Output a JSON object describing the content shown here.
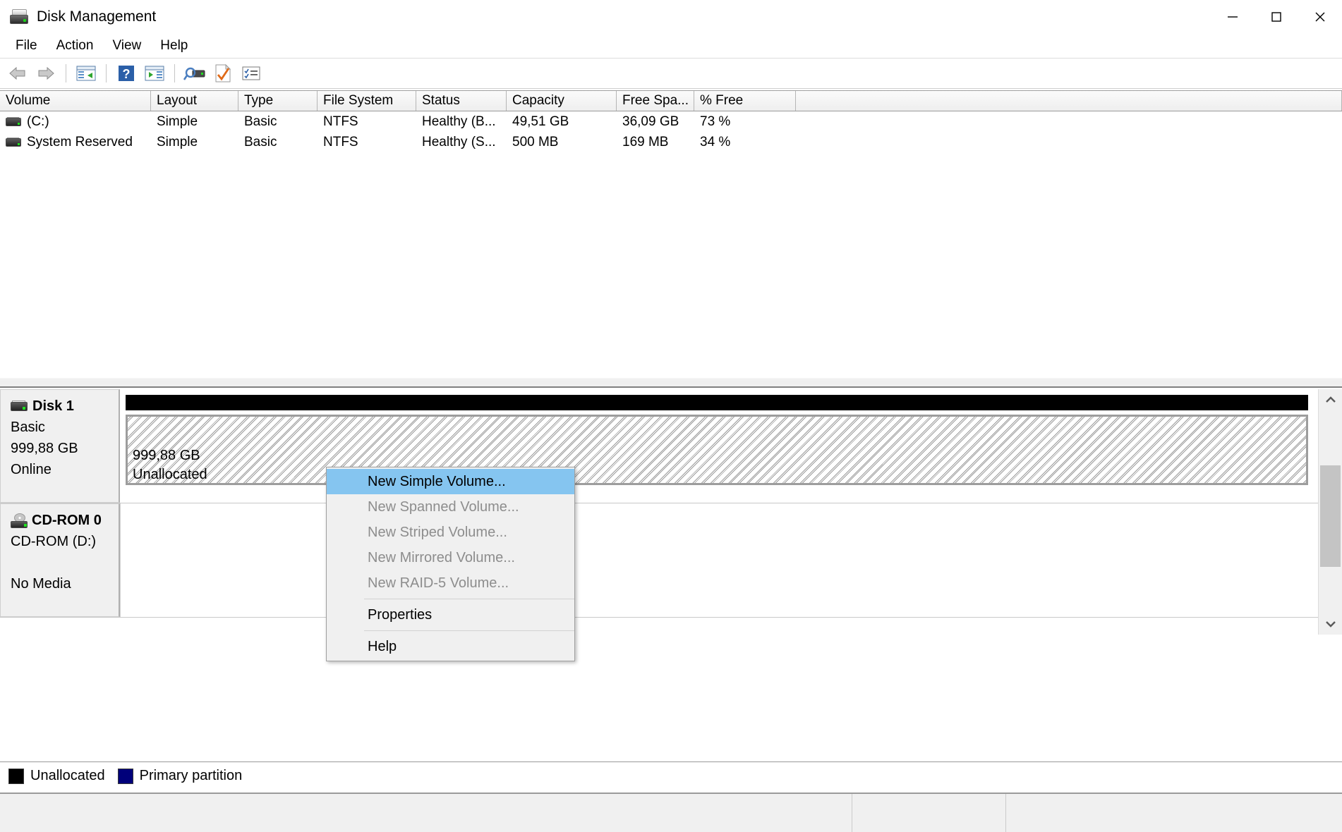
{
  "window": {
    "title": "Disk Management",
    "icon": "disk-drive-icon",
    "controls": {
      "minimize": "minimize-icon",
      "maximize": "maximize-icon",
      "close": "close-icon"
    }
  },
  "menubar": {
    "items": [
      {
        "label": "File"
      },
      {
        "label": "Action"
      },
      {
        "label": "View"
      },
      {
        "label": "Help"
      }
    ]
  },
  "toolbar": {
    "buttons": [
      {
        "name": "back-icon"
      },
      {
        "name": "forward-icon"
      },
      {
        "name": "show-hide-console-tree-icon"
      },
      {
        "name": "help-icon"
      },
      {
        "name": "show-hide-action-pane-icon"
      },
      {
        "name": "rescan-disks-icon"
      },
      {
        "name": "properties-icon"
      },
      {
        "name": "list-view-icon"
      }
    ]
  },
  "volume_list": {
    "columns": [
      "Volume",
      "Layout",
      "Type",
      "File System",
      "Status",
      "Capacity",
      "Free Spa...",
      "% Free"
    ],
    "rows": [
      {
        "volume": "(C:)",
        "layout": "Simple",
        "type": "Basic",
        "file_system": "NTFS",
        "status": "Healthy (B...",
        "capacity": "49,51 GB",
        "free_space": "36,09 GB",
        "percent_free": "73 %"
      },
      {
        "volume": "System Reserved",
        "layout": "Simple",
        "type": "Basic",
        "file_system": "NTFS",
        "status": "Healthy (S...",
        "capacity": "500 MB",
        "free_space": "169 MB",
        "percent_free": "34 %"
      }
    ]
  },
  "graphical_view": {
    "disks": [
      {
        "name": "Disk 1",
        "type": "Basic",
        "size": "999,88 GB",
        "state": "Online",
        "partition": {
          "size": "999,88 GB",
          "label": "Unallocated"
        }
      },
      {
        "name": "CD-ROM 0",
        "type": "CD-ROM (D:)",
        "size": "",
        "state": "No Media"
      }
    ]
  },
  "legend": {
    "items": [
      {
        "label": "Unallocated",
        "color": "#000000"
      },
      {
        "label": "Primary partition",
        "color": "#00007a"
      }
    ]
  },
  "context_menu": {
    "items": [
      {
        "label": "New Simple Volume...",
        "state": "highlighted"
      },
      {
        "label": "New Spanned Volume...",
        "state": "disabled"
      },
      {
        "label": "New Striped Volume...",
        "state": "disabled"
      },
      {
        "label": "New Mirrored Volume...",
        "state": "disabled"
      },
      {
        "label": "New RAID-5 Volume...",
        "state": "disabled"
      },
      {
        "label": "separator",
        "state": "separator"
      },
      {
        "label": "Properties",
        "state": "enabled"
      },
      {
        "label": "separator",
        "state": "separator"
      },
      {
        "label": "Help",
        "state": "enabled"
      }
    ]
  },
  "colors": {
    "highlight": "#85c5f0",
    "unallocated": "#000000",
    "primary_partition": "#00007a"
  }
}
